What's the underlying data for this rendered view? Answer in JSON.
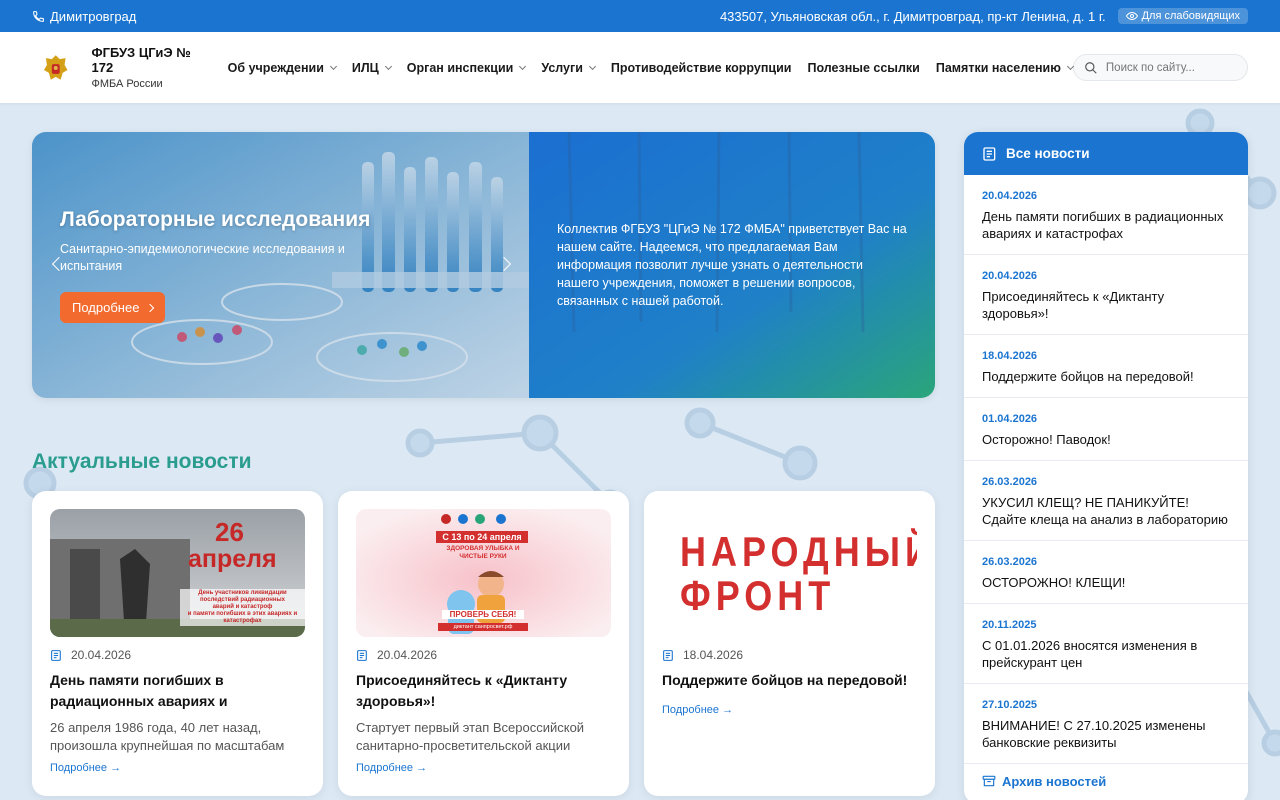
{
  "topbar": {
    "city": "Димитровград",
    "address": "433507, Ульяновская обл., г. Димитровград, пр-кт Ленина, д. 1 г.",
    "visually_impaired": "Для слабовидящих"
  },
  "header": {
    "org_name": "ФГБУЗ ЦГиЭ № 172",
    "org_sub": "ФМБА России",
    "nav": [
      {
        "label": "Об учреждении",
        "dropdown": true
      },
      {
        "label": "ИЛЦ",
        "dropdown": true
      },
      {
        "label": "Орган инспекции",
        "dropdown": true
      },
      {
        "label": "Услуги",
        "dropdown": true
      },
      {
        "label": "Противодействие коррупции",
        "dropdown": false
      },
      {
        "label": "Полезные ссылки",
        "dropdown": false
      },
      {
        "label": "Памятки населению",
        "dropdown": true
      }
    ],
    "search_placeholder": "Поиск по сайту..."
  },
  "hero": {
    "title": "Лабораторные исследования",
    "subtitle": "Санитарно-эпидемиологические исследования и испытания",
    "button": "Подробнее",
    "welcome": "Коллектив ФГБУЗ \"ЦГиЭ № 172 ФМБА\" приветствует Вас на нашем сайте. Надеемся, что предлагаемая Вам информация позволит лучше узнать о деятельности нашего учреждения, поможет в решении вопросов, связанных с нашей работой."
  },
  "news_section": {
    "title": "Актуальные новости",
    "cards": [
      {
        "date": "20.04.2026",
        "title": "День памяти погибших в радиационных авариях и катастрофах",
        "excerpt": "26 апреля 1986 года, 40 лет назад, произошла крупнейшая по масштабам авария",
        "more": "Подробнее →",
        "image_text": [
          "26",
          "апреля",
          "День участников ликвидации",
          "последствий радиационных",
          "аварий и катастроф",
          "и памяти погибших в этих авариях и катастрофах"
        ]
      },
      {
        "date": "20.04.2026",
        "title": "Присоединяйтесь к «Диктанту здоровья»!",
        "excerpt": "Стартует первый этап Всероссийской санитарно-просветительской акции",
        "more": "Подробнее →",
        "image_text": [
          "С 13 по 24 апреля",
          "ЗДОРОВАЯ УЛЫБКА И ЧИСТЫЕ РУКИ",
          "ПРОВЕРЬ СЕБЯ!",
          "диктант санпросвет.рф"
        ]
      },
      {
        "date": "18.04.2026",
        "title": "Поддержите бойцов на передовой!",
        "excerpt": "",
        "more": "Подробнее →",
        "image_text": [
          "НАРОДНЫЙ",
          "ФРОНТ"
        ]
      }
    ]
  },
  "sidebar": {
    "title": "Все новости",
    "items": [
      {
        "date": "20.04.2026",
        "title": "День памяти погибших в радиационных авариях и катастрофах"
      },
      {
        "date": "20.04.2026",
        "title": "Присоединяйтесь к «Диктанту здоровья»!"
      },
      {
        "date": "18.04.2026",
        "title": "Поддержите бойцов на передовой!"
      },
      {
        "date": "01.04.2026",
        "title": "Осторожно! Паводок!"
      },
      {
        "date": "26.03.2026",
        "title": "УКУСИЛ КЛЕЩ? НЕ ПАНИКУЙТЕ! Сдайте клеща на анализ в лабораторию"
      },
      {
        "date": "26.03.2026",
        "title": "ОСТОРОЖНО! КЛЕЩИ!"
      },
      {
        "date": "20.11.2025",
        "title": "С 01.01.2026 вносятся изменения в прейскурант цен"
      },
      {
        "date": "27.10.2025",
        "title": "ВНИМАНИЕ! С 27.10.2025 изменены банковские реквизиты"
      }
    ],
    "archive": "Архив новостей"
  },
  "colors": {
    "primary": "#1b75d0",
    "accent": "#f26a2e",
    "section_title": "#2a9d8f"
  }
}
